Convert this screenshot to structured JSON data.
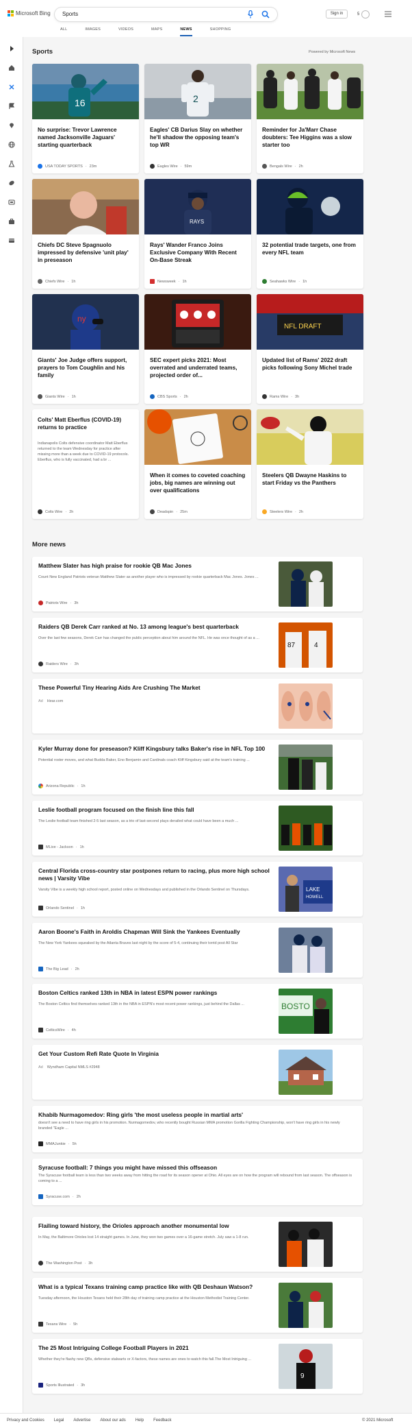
{
  "header": {
    "brand": "Microsoft Bing",
    "search_value": "Sports",
    "signin_label": "Sign in",
    "rewards_points": "5",
    "tabs": [
      {
        "label": "ALL"
      },
      {
        "label": "IMAGES"
      },
      {
        "label": "VIDEOS"
      },
      {
        "label": "MAPS"
      },
      {
        "label": "NEWS"
      },
      {
        "label": "SHOPPING"
      }
    ]
  },
  "rail_icons": [
    "expand-icon",
    "home-icon",
    "discover-icon",
    "flag-icon",
    "location-icon",
    "globe-icon",
    "science-icon",
    "sports-icon",
    "tv-icon",
    "briefcase-icon",
    "payment-icon"
  ],
  "sports": {
    "title": "Sports",
    "powered_by": "Powered by Microsoft News",
    "cards": [
      {
        "title": "No surprise: Trevor Lawrence named Jacksonville Jaguars' starting quarterback",
        "source": "USA TODAY SPORTS",
        "age": "23m",
        "src_color": "#1a73e8"
      },
      {
        "title": "Eagles' CB Darius Slay on whether he'll shadow the opposing team's top WR",
        "source": "Eagles Wire",
        "age": "59m",
        "src_color": "#333333"
      },
      {
        "title": "Reminder for Ja'Marr Chase doubters: Tee Higgins was a slow starter too",
        "source": "Bengals Wire",
        "age": "2h",
        "src_color": "#555555"
      },
      {
        "title": "Chiefs DC Steve Spagnuolo impressed by defensive 'unit play' in preseason",
        "source": "Chiefs Wire",
        "age": "1h",
        "src_color": "#666666"
      },
      {
        "title": "Rays' Wander Franco Joins Exclusive Company With Recent On-Base Streak",
        "source": "Newsweek",
        "age": "1h",
        "src_color": "#d32f2f"
      },
      {
        "title": "32 potential trade targets, one from every NFL team",
        "source": "Seahawks Wire",
        "age": "1h",
        "src_color": "#2e7d32"
      },
      {
        "title": "Giants' Joe Judge offers support, prayers to Tom Coughlin and his family",
        "source": "Giants Wire",
        "age": "1h",
        "src_color": "#555555"
      },
      {
        "title": "SEC expert picks 2021: Most overrated and underrated teams, projected order of...",
        "source": "CBS Sports",
        "age": "2h",
        "src_color": "#1565c0"
      },
      {
        "title": "Updated list of Rams' 2022 draft picks following Sony Michel trade",
        "source": "Rams Wire",
        "age": "3h",
        "src_color": "#333333"
      },
      {
        "title": "Colts' Matt Eberflus (COVID-19) returns to practice",
        "summary": "Indianapolis Colts defensive coordinator Matt Eberflus returned to the team Wednesday for practice after missing more than a week due to COVID-19 protocols. Eberflus, who is fully vaccinated, had a br ...",
        "source": "Colts Wire",
        "age": "2h",
        "src_color": "#333333"
      },
      {
        "title": "When it comes to coveted coaching jobs, big names are winning out over qualifications",
        "source": "Deadspin",
        "age": "25m",
        "src_color": "#444444"
      },
      {
        "title": "Steelers QB Dwayne Haskins to start Friday vs the Panthers",
        "source": "Steelers Wire",
        "age": "2h",
        "src_color": "#f9a825"
      }
    ]
  },
  "more_news": {
    "title": "More news",
    "items": [
      {
        "title": "Matthew Slater has high praise for rookie QB Mac Jones",
        "summary": "Count New England Patriots veteran Matthew Slater as another player who is impressed by rookie quarterback Mac Jones. Jones ...",
        "source": "Patriots Wire",
        "age": "3h"
      },
      {
        "title": "Raiders QB Derek Carr ranked at No. 13 among league's best quarterback",
        "summary": "Over the last few seasons, Derek Carr has changed the public perception about him around the NFL. He was once thought of as a ...",
        "source": "Raiders Wire",
        "age": "3h"
      },
      {
        "title": "These Powerful Tiny Hearing Aids Are Crushing The Market",
        "summary": "",
        "ad": "Ad",
        "source": "Hear.com",
        "age": ""
      },
      {
        "title": "Kyler Murray done for preseason? Kliff Kingsbury talks Baker's rise in NFL Top 100",
        "summary": "Potential roster moves, and what Budda Baker, Eno Benjamin and Cardinals coach Kliff Kingsbury said at the team's training ...",
        "source": "Arizona Republic",
        "age": "1h"
      },
      {
        "title": "Leslie football program focused on the finish line this fall",
        "summary": "The Leslie football team finished 2-5 last season, as a trio of last-second plays derailed what could have been a much ...",
        "source": "MLive - Jackson",
        "age": "1h"
      },
      {
        "title": "Central Florida cross-country star postpones return to racing, plus more high school news | Varsity Vibe",
        "summary": "Varsity Vibe is a weekly high school report, posted online on Wednesdays and published in the Orlando Sentinel on Thursdays.",
        "source": "Orlando Sentinel",
        "age": "1h"
      },
      {
        "title": "Aaron Boone's Faith in Aroldis Chapman Will Sink the Yankees Eventually",
        "summary": "The New York Yankees squeaked by the Atlanta Braves last night by the score of 5-4, continuing their torrid post All Star",
        "source": "The Big Lead",
        "age": "2h"
      },
      {
        "title": "Boston Celtics ranked 13th in NBA in latest ESPN power rankings",
        "summary": "The Boston Celtics find themselves ranked 13th in the NBA in ESPN's most recent power rankings, just behind the Dallas ...",
        "source": "CelticsWire",
        "age": "4h"
      },
      {
        "title": "Get Your Custom Refi Rate Quote In Virginia",
        "summary": "",
        "ad": "Ad",
        "source": "Wyndham Capital NMLS #2948",
        "age": ""
      },
      {
        "title": "Khabib Nurmagomedov: Ring girls 'the most useless people in martial arts'",
        "summary": "doesn't see a need to have ring girls in his promotion. Nurmagomedov, who recently bought Russian MMA promotion Gorilla Fighting Championship, won't have ring girls in his newly branded \"Eagle ...",
        "source": "MMAJunkie",
        "age": "5h"
      },
      {
        "title": "Syracuse football: 7 things you might have missed this offseason",
        "summary": "The Syracuse football team is less than two weeks away from hitting the road for its season opener at Ohio. All eyes are on how the program will rebound from last season. The offseason is coming to a ...",
        "source": "Syracuse.com",
        "age": "2h"
      },
      {
        "title": "Flailing toward history, the Orioles approach another monumental low",
        "summary": "In May, the Baltimore Orioles lost 14 straight games. In June, they won two games over a 16-game stretch. July saw a 1-8 run.",
        "source": "The Washington Post",
        "age": "3h"
      },
      {
        "title": "What is a typical Texans training camp practice like with QB Deshaun Watson?",
        "summary": "Tuesday afternoon, the Houston Texans held their 28th day of training camp practice at the Houston Methodist Training Center.",
        "source": "Texans Wire",
        "age": "5h"
      },
      {
        "title": "The 25 Most Intriguing College Football Players in 2021",
        "summary": "Whether they're flashy new QBs, defensive stalwarts or X-factors, these names are ones to watch this fall.The Most Intriguing ...",
        "source": "Sports Illustrated",
        "age": "3h"
      }
    ]
  },
  "footer": {
    "links": [
      "Privacy and Cookies",
      "Legal",
      "Advertise",
      "About our ads",
      "Help",
      "Feedback"
    ],
    "copyright": "© 2021 Microsoft"
  }
}
